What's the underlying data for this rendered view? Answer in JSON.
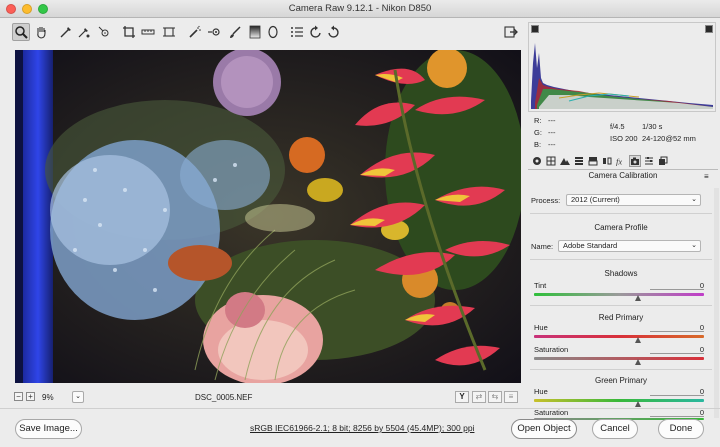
{
  "window": {
    "title": "Camera Raw 9.12.1  -  Nikon D850"
  },
  "toolbar": {
    "tools": [
      "zoom-icon",
      "hand-icon",
      "white-balance-icon",
      "color-sampler-icon",
      "targeted-adjustment-icon",
      "crop-icon",
      "straighten-icon",
      "transform-icon",
      "spot-removal-icon",
      "red-eye-icon",
      "adjustment-brush-icon",
      "graduated-filter-icon",
      "radial-filter-icon",
      "list-icon",
      "rotate-ccw-icon",
      "rotate-cw-icon"
    ],
    "preferences_icon": "export-icon"
  },
  "bottom": {
    "zoom_minus": "−",
    "zoom_plus": "+",
    "zoom_value": "9%",
    "zoom_dropdown": "⌄",
    "filename": "DSC_0005.NEF",
    "view_y": "Y"
  },
  "footer": {
    "save_image": "Save Image...",
    "workflow": "sRGB IEC61966-2.1; 8 bit; 8256 by 5504 (45.4MP); 300 ppi",
    "open_object": "Open Object",
    "cancel": "Cancel",
    "done": "Done"
  },
  "info": {
    "r_label": "R:",
    "r_val": "---",
    "g_label": "G:",
    "g_val": "---",
    "b_label": "B:",
    "b_val": "---",
    "aperture": "f/4.5",
    "shutter": "1/30 s",
    "iso": "ISO 200",
    "lens": "24-120@52 mm"
  },
  "panel": {
    "title": "Camera Calibration",
    "menu_icon": "≡",
    "process_label": "Process:",
    "process_value": "2012 (Current)",
    "camera_profile_head": "Camera Profile",
    "name_label": "Name:",
    "name_value": "Adobe Standard",
    "shadows_head": "Shadows",
    "tint_label": "Tint",
    "tint_value": "0",
    "red_head": "Red Primary",
    "red_hue_label": "Hue",
    "red_hue_value": "0",
    "red_sat_label": "Saturation",
    "red_sat_value": "0",
    "green_head": "Green Primary",
    "green_hue_label": "Hue",
    "green_hue_value": "0",
    "green_sat_label": "Saturation",
    "green_sat_value": "0"
  },
  "colors": {
    "close": "#fc5f57",
    "minimize": "#fdbc2e",
    "zoom": "#33c748"
  }
}
